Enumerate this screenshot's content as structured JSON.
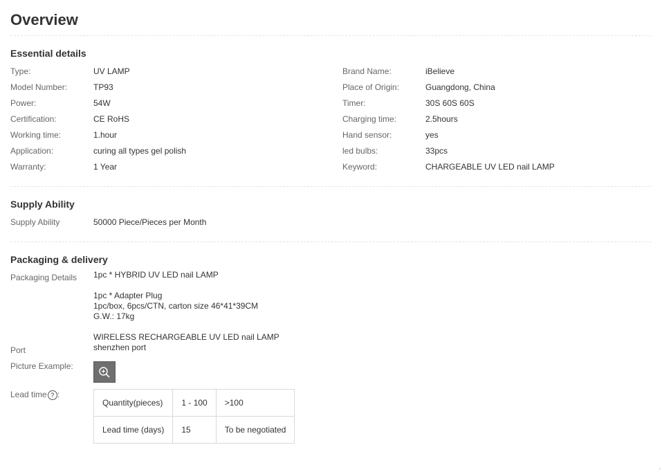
{
  "page": {
    "title": "Overview"
  },
  "essential": {
    "title": "Essential details",
    "left": [
      {
        "label": "Type:",
        "value": "UV LAMP"
      },
      {
        "label": "Model Number:",
        "value": "TP93"
      },
      {
        "label": "Power:",
        "value": "54W"
      },
      {
        "label": "Certification:",
        "value": "CE RoHS"
      },
      {
        "label": "Working time:",
        "value": "1.hour"
      },
      {
        "label": "Application:",
        "value": "curing all types gel polish"
      },
      {
        "label": "Warranty:",
        "value": "1 Year"
      }
    ],
    "right": [
      {
        "label": "Brand Name:",
        "value": "iBelieve"
      },
      {
        "label": "Place of Origin:",
        "value": "Guangdong, China"
      },
      {
        "label": "Timer:",
        "value": "30S 60S 60S"
      },
      {
        "label": "Charging time:",
        "value": "2.5hours"
      },
      {
        "label": "Hand sensor:",
        "value": "yes"
      },
      {
        "label": "led bulbs:",
        "value": "33pcs"
      },
      {
        "label": "Keyword:",
        "value": "CHARGEABLE UV LED nail LAMP"
      }
    ]
  },
  "supply": {
    "title": "Supply Ability",
    "label": "Supply Ability",
    "value": "50000 Piece/Pieces per Month"
  },
  "packaging": {
    "title": "Packaging & delivery",
    "details_label": "Packaging Details",
    "details_lines": [
      "1pc * HYBRID UV LED nail LAMP",
      "",
      "1pc * Adapter Plug",
      "1pc/box, 6pcs/CTN, carton size 46*41*39CM",
      "G.W.: 17kg",
      "",
      "WIRELESS RECHARGEABLE UV LED nail LAMP",
      "shenzhen port"
    ],
    "port_label": "Port",
    "picture_label": "Picture Example:",
    "picture_icon": "zoom-in-icon",
    "lead_label": "Lead time",
    "lead_help_icon": "question-icon",
    "lead_help_glyph": "?",
    "lead_colon": ":",
    "lead_table": {
      "rows": [
        [
          "Quantity(pieces)",
          "1 - 100",
          ">100"
        ],
        [
          "Lead time (days)",
          "15",
          "To be negotiated"
        ]
      ]
    }
  },
  "corner_mark": "."
}
